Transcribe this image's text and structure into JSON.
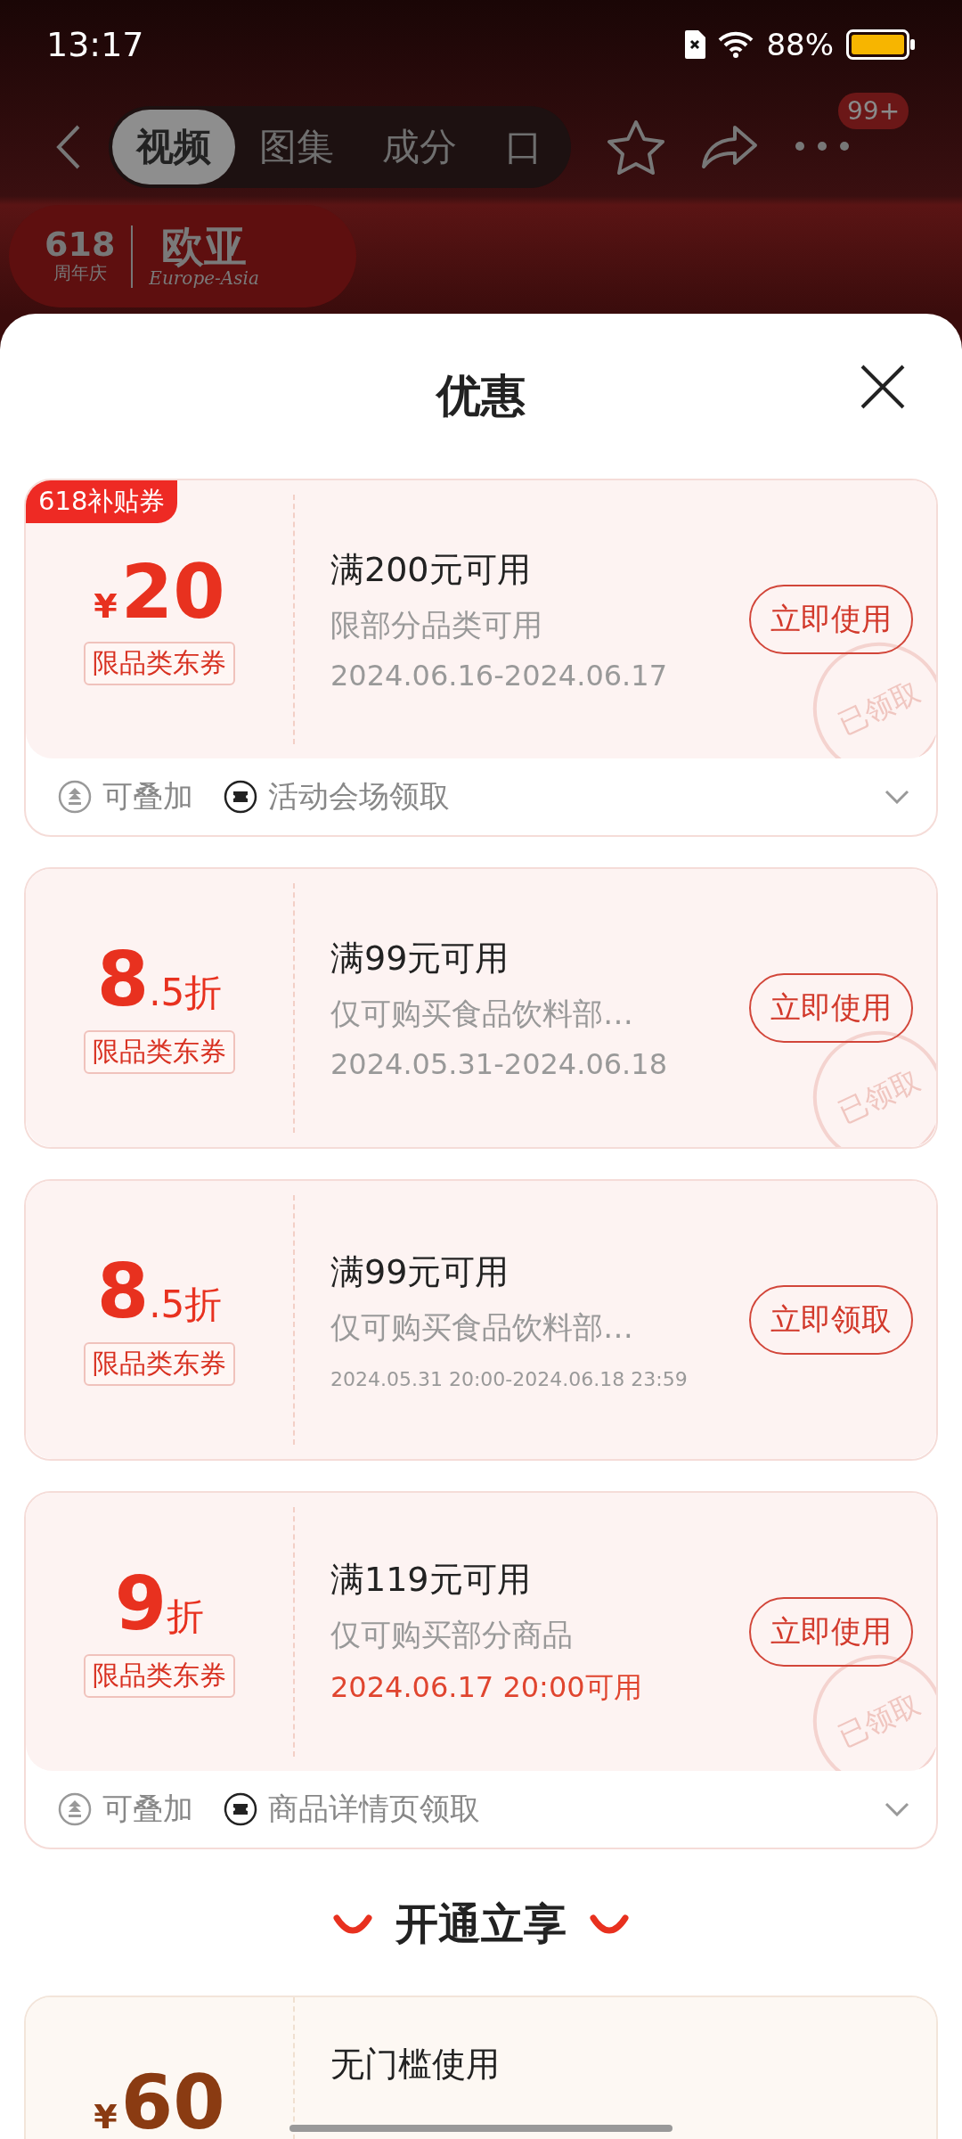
{
  "status_bar": {
    "time": "13:17",
    "battery": "88%"
  },
  "nav": {
    "tabs": [
      {
        "label": "视频",
        "selected": true
      },
      {
        "label": "图集",
        "selected": false
      },
      {
        "label": "成分",
        "selected": false
      },
      {
        "label": "口",
        "selected": false
      }
    ],
    "badge": "99+"
  },
  "brand": {
    "anniversary": "618",
    "anniversary_caption": "周年庆",
    "name": "欧亚",
    "name_latin": "Europe-Asia"
  },
  "sheet": {
    "title": "优惠",
    "coupons": [
      {
        "badge": "618补贴券",
        "prefix": "¥",
        "main": "20",
        "tag": "限品类东券",
        "title": "满200元可用",
        "desc": "限部分品类可用",
        "date": "2024.06.16-2024.06.17",
        "date_compact": false,
        "date_highlight": false,
        "button": "立即使用",
        "stamp": "已领取",
        "footer": [
          {
            "kind": "stack",
            "text": "可叠加"
          },
          {
            "kind": "ticket",
            "text": "活动会场领取"
          }
        ]
      },
      {
        "main": "8",
        "suffix": ".5折",
        "tag": "限品类东券",
        "title": "满99元可用",
        "desc": "仅可购买食品饮料部…",
        "date": "2024.05.31-2024.06.18",
        "date_compact": false,
        "date_highlight": false,
        "button": "立即使用",
        "stamp": "已领取"
      },
      {
        "main": "8",
        "suffix": ".5折",
        "tag": "限品类东券",
        "title": "满99元可用",
        "desc": "仅可购买食品饮料部…",
        "date": "2024.05.31 20:00-2024.06.18 23:59",
        "date_compact": true,
        "date_highlight": false,
        "button": "立即领取"
      },
      {
        "main": "9",
        "suffix": "折",
        "tag": "限品类东券",
        "title": "满119元可用",
        "desc": "仅可购买部分商品",
        "date": "2024.06.17 20:00可用",
        "date_compact": false,
        "date_highlight": true,
        "button": "立即使用",
        "stamp": "已领取",
        "footer": [
          {
            "kind": "stack",
            "text": "可叠加"
          },
          {
            "kind": "ticket",
            "text": "商品详情页领取"
          }
        ]
      }
    ],
    "section_title": "开通立享",
    "member_coupon": {
      "prefix": "¥",
      "main": "60",
      "title": "无门槛使用"
    }
  }
}
